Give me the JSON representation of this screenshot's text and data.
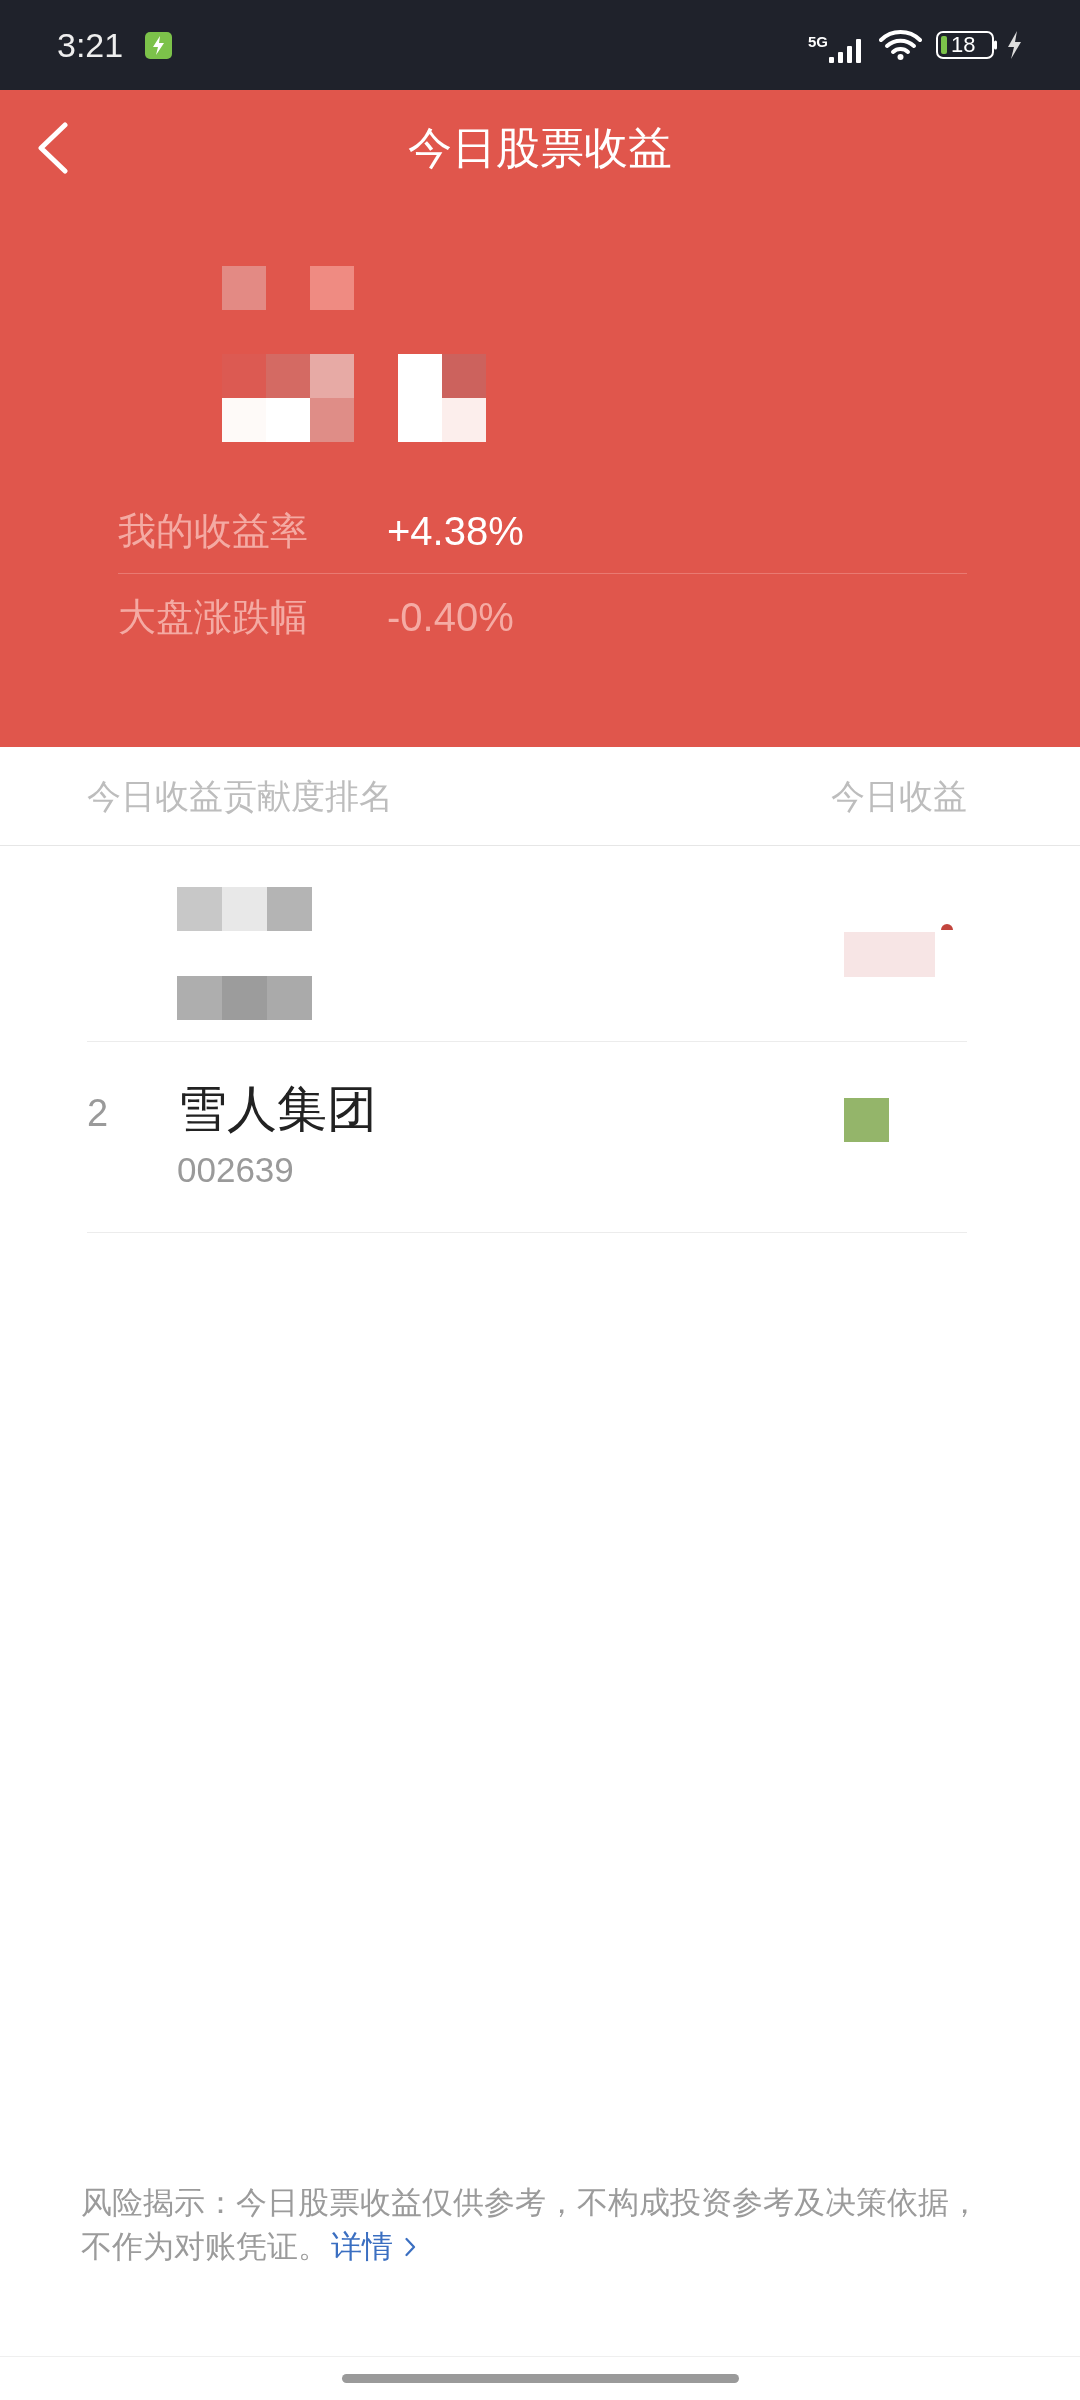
{
  "status_bar": {
    "time": "3:21",
    "network": "5G",
    "battery": "18"
  },
  "header": {
    "title": "今日股票收益"
  },
  "summary": [
    {
      "label": "我的收益率",
      "value": "+4.38%",
      "highlighted": true
    },
    {
      "label": "大盘涨跌幅",
      "value": "-0.40%",
      "highlighted": false
    }
  ],
  "ranking": {
    "columns": [
      "今日收益贡献度排名",
      "今日收益"
    ],
    "rows": [
      {
        "kind": "redacted",
        "color": "#f7e5e5"
      },
      {
        "kind": "stock",
        "rank": "2",
        "name": "雪人集团",
        "code": "002639",
        "color": "#94b56a"
      }
    ]
  },
  "footer": {
    "disclaimer": "风险揭示：今日股票收益仅供参考，不构成投资参考及决策依据，不作为对账凭证。",
    "link": "详情"
  }
}
